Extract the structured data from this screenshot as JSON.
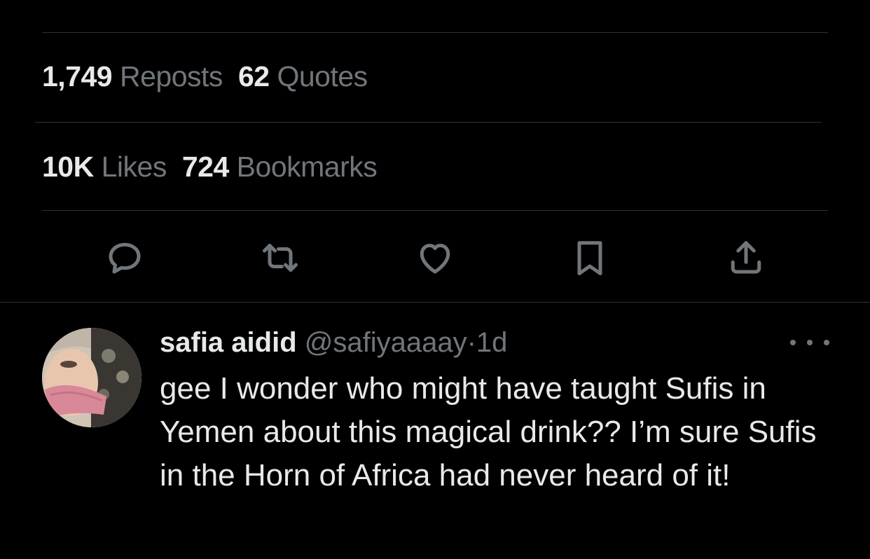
{
  "post": {
    "cut_text": "",
    "stats_row1": [
      {
        "count": "1,749",
        "label": "Reposts"
      },
      {
        "count": "62",
        "label": "Quotes"
      }
    ],
    "stats_row2": [
      {
        "count": "10K",
        "label": "Likes"
      },
      {
        "count": "724",
        "label": "Bookmarks"
      }
    ],
    "actions": [
      "reply-icon",
      "repost-icon",
      "like-icon",
      "bookmark-icon",
      "share-icon"
    ]
  },
  "reply": {
    "name": "safia aidid",
    "handle": "@safiyaaaay",
    "separator": "·",
    "time": "1d",
    "text": "gee I wonder who might have taught Sufis in Yemen about this magical drink?? I’m sure Sufis in the Horn of Africa had never heard of it!"
  },
  "colors": {
    "background": "#000000",
    "primary_text": "#e7e9ea",
    "secondary_text": "#71767b",
    "divider": "#2f3336"
  }
}
